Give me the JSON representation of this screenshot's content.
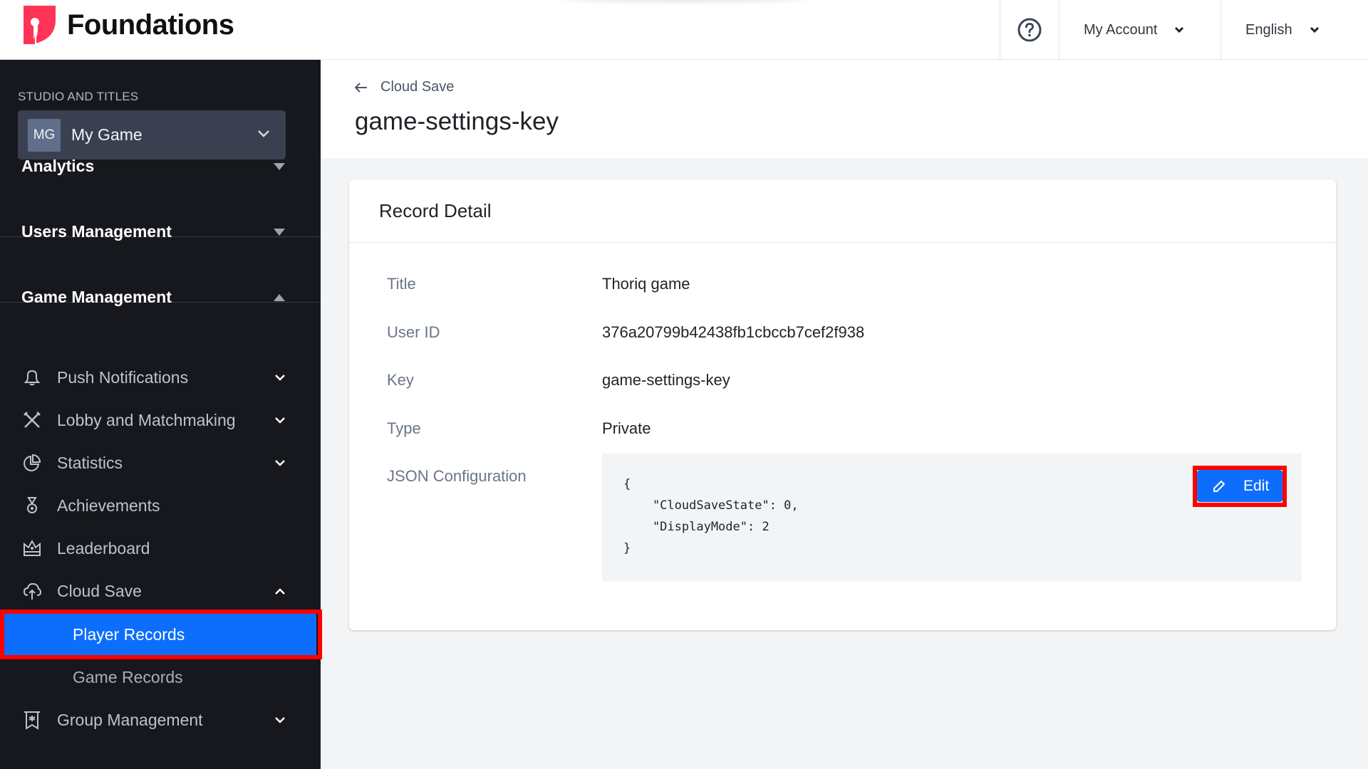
{
  "header": {
    "brand": "Foundations",
    "help_icon": "question-circle-icon",
    "account_label": "My Account",
    "language_label": "English"
  },
  "sidebar": {
    "studio_label": "STUDIO AND TITLES",
    "studio": {
      "avatar": "MG",
      "name": "My Game"
    },
    "sections": [
      {
        "label": "Analytics",
        "expanded": false
      },
      {
        "label": "Users Management",
        "expanded": false
      },
      {
        "label": "Game Management",
        "expanded": true
      }
    ],
    "items": [
      {
        "label": "Push Notifications",
        "icon": "bell-icon",
        "has_children": true
      },
      {
        "label": "Lobby and Matchmaking",
        "icon": "crossed-swords-icon",
        "has_children": true
      },
      {
        "label": "Statistics",
        "icon": "pie-chart-icon",
        "has_children": true
      },
      {
        "label": "Achievements",
        "icon": "medal-icon",
        "has_children": false
      },
      {
        "label": "Leaderboard",
        "icon": "crown-icon",
        "has_children": false
      },
      {
        "label": "Cloud Save",
        "icon": "cloud-upload-icon",
        "has_children": true,
        "expanded": true
      },
      {
        "label": "Group Management",
        "icon": "banner-star-icon",
        "has_children": true
      }
    ],
    "cloud_save_children": [
      {
        "label": "Player Records",
        "active": true
      },
      {
        "label": "Game Records",
        "active": false
      }
    ]
  },
  "page": {
    "back_label": "Cloud Save",
    "title": "game-settings-key"
  },
  "record": {
    "card_title": "Record Detail",
    "fields": [
      {
        "label": "Title",
        "value": "Thoriq game"
      },
      {
        "label": "User ID",
        "value": "376a20799b42438fb1cbccb7cef2f938"
      },
      {
        "label": "Key",
        "value": "game-settings-key"
      },
      {
        "label": "Type",
        "value": "Private"
      }
    ],
    "json_label": "JSON Configuration",
    "json_text": "{\n    \"CloudSaveState\": 0,\n    \"DisplayMode\": 2\n}",
    "edit_label": "Edit"
  },
  "colors": {
    "brand": "#ff3355",
    "accent": "#0d6efd",
    "highlight_outline": "#ff0000",
    "sidebar_bg": "#16181d"
  }
}
